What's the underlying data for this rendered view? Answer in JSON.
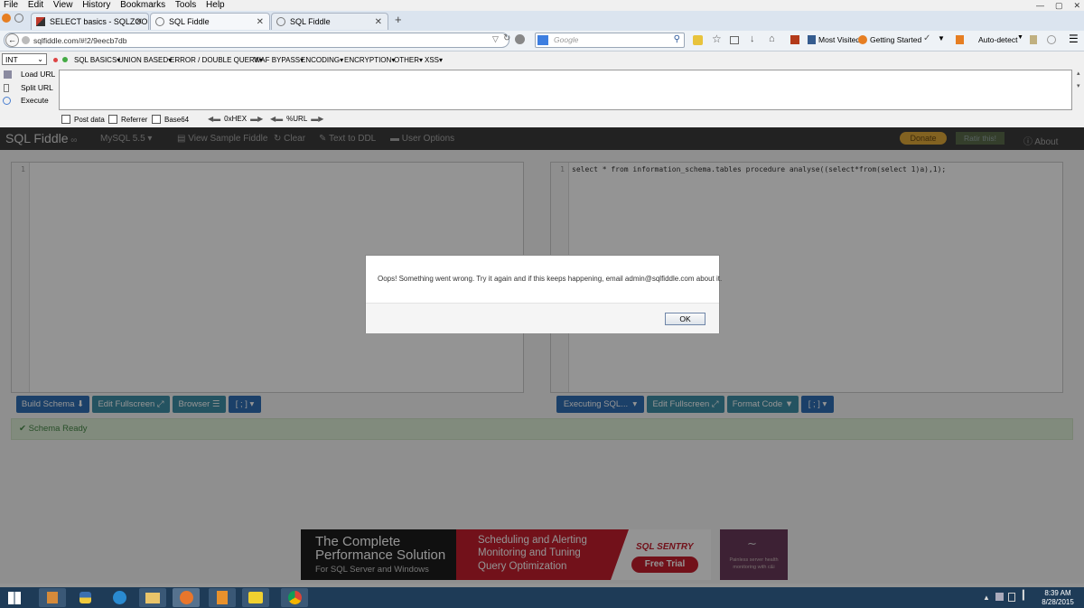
{
  "menubar": {
    "items": [
      "File",
      "Edit",
      "View",
      "History",
      "Bookmarks",
      "Tools",
      "Help"
    ]
  },
  "tabs": [
    {
      "label": "SELECT basics - SQLZOO"
    },
    {
      "label": "SQL Fiddle"
    },
    {
      "label": "SQL Fiddle"
    }
  ],
  "nav": {
    "url": "sqlfiddle.com/#!2/9eecb7db",
    "search_placeholder": "Google",
    "most_visited": "Most Visited",
    "getting_started": "Getting Started",
    "auto_detect": "Auto-detect"
  },
  "hackbar": {
    "type_select": "INT",
    "menus": [
      "SQL BASICS",
      "UNION BASED",
      "ERROR / DOUBLE QUERY",
      "WAF BYPASS",
      "ENCODING",
      "ENCRYPTION",
      "OTHER",
      "XSS"
    ],
    "load_url": "Load URL",
    "split_url": "Split URL",
    "execute": "Execute",
    "post_data": "Post data",
    "referrer": "Referrer",
    "base64": "Base64",
    "hex": "0xHEX",
    "url_enc": "%URL"
  },
  "fiddle": {
    "logo": "SQL Fiddle",
    "db": "MySQL 5.5",
    "view_sample": "View Sample Fiddle",
    "clear": "Clear",
    "text_to_ddl": "Text to DDL",
    "user_options": "User Options",
    "donate": "Donate",
    "ratir": "Ratir this!",
    "about": "About",
    "left_line": "1",
    "right_line": "1",
    "query": "select * from information_schema.tables procedure analyse((select*from(select 1)a),1);",
    "build_schema": "Build Schema",
    "edit_fullscreen_left": "Edit Fullscreen",
    "browser": "Browser",
    "left_delim": "[ ; ]",
    "executing": "Executing SQL...",
    "edit_fullscreen_right": "Edit Fullscreen",
    "format_code": "Format Code",
    "right_delim": "[ ; ]",
    "status": "Schema Ready"
  },
  "modal": {
    "message": "Oops! Something went wrong. Try it again and if this keeps happening, email admin@sqlfiddle.com about it.",
    "ok": "OK"
  },
  "ad": {
    "headline1": "The Complete",
    "headline2": "Performance Solution",
    "sub": "For SQL Server and Windows",
    "mid1": "Scheduling and Alerting",
    "mid2": "Monitoring and Tuning",
    "mid3": "Query Optimization",
    "brand": "SQL SENTRY",
    "trial": "Free Trial",
    "side": "Painless server health monitoring with c&i"
  },
  "taskbar": {
    "time": "8:39 AM",
    "date": "8/28/2015"
  },
  "colors": {
    "accent_blue": "#2f6fb5",
    "teal": "#3f8fa8",
    "status_green": "#dff0d8",
    "navbar_dark": "#3b3b3b"
  }
}
